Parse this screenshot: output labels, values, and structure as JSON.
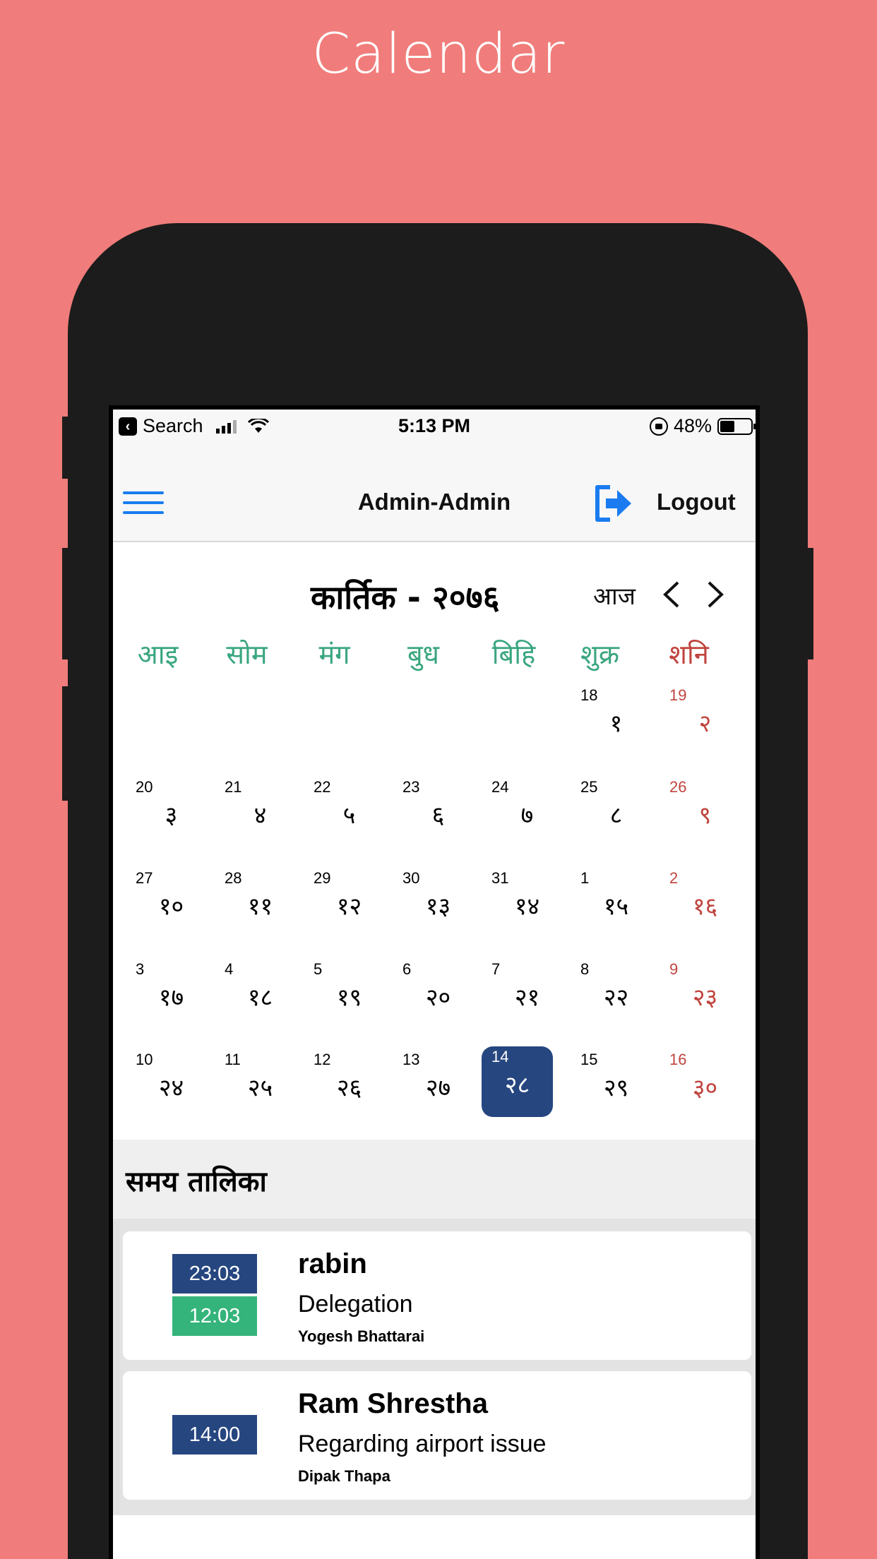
{
  "promo": {
    "title": "Calendar"
  },
  "status_bar": {
    "back_app": "Search",
    "time": "5:13 PM",
    "battery": "48%"
  },
  "nav": {
    "title": "Admin-Admin",
    "logout_label": "Logout"
  },
  "calendar": {
    "month_title": "कार्तिक - २०७६",
    "today_label": "आज",
    "weekdays": [
      "आइ",
      "सोम",
      "मंग",
      "बुध",
      "बिहि",
      "शुक्र",
      "शनि"
    ],
    "weeks": [
      [
        null,
        null,
        null,
        null,
        null,
        {
          "ad": "18",
          "bs": "१"
        },
        {
          "ad": "19",
          "bs": "२"
        }
      ],
      [
        {
          "ad": "20",
          "bs": "३"
        },
        {
          "ad": "21",
          "bs": "४"
        },
        {
          "ad": "22",
          "bs": "५"
        },
        {
          "ad": "23",
          "bs": "६"
        },
        {
          "ad": "24",
          "bs": "७"
        },
        {
          "ad": "25",
          "bs": "८"
        },
        {
          "ad": "26",
          "bs": "९"
        }
      ],
      [
        {
          "ad": "27",
          "bs": "१०"
        },
        {
          "ad": "28",
          "bs": "११"
        },
        {
          "ad": "29",
          "bs": "१२"
        },
        {
          "ad": "30",
          "bs": "१३"
        },
        {
          "ad": "31",
          "bs": "१४"
        },
        {
          "ad": "1",
          "bs": "१५"
        },
        {
          "ad": "2",
          "bs": "१६"
        }
      ],
      [
        {
          "ad": "3",
          "bs": "१७"
        },
        {
          "ad": "4",
          "bs": "१८"
        },
        {
          "ad": "5",
          "bs": "१९"
        },
        {
          "ad": "6",
          "bs": "२०"
        },
        {
          "ad": "7",
          "bs": "२१"
        },
        {
          "ad": "8",
          "bs": "२२"
        },
        {
          "ad": "9",
          "bs": "२३"
        }
      ],
      [
        {
          "ad": "10",
          "bs": "२४"
        },
        {
          "ad": "11",
          "bs": "२५"
        },
        {
          "ad": "12",
          "bs": "२६"
        },
        {
          "ad": "13",
          "bs": "२७"
        },
        {
          "ad": "14",
          "bs": "२८",
          "today": true
        },
        {
          "ad": "15",
          "bs": "२९"
        },
        {
          "ad": "16",
          "bs": "३०"
        }
      ]
    ]
  },
  "schedule": {
    "title": "समय तालिका",
    "events": [
      {
        "start": "23:03",
        "end": "12:03",
        "title": "rabin",
        "subtitle": "Delegation",
        "person": "Yogesh Bhattarai"
      },
      {
        "start": "14:00",
        "title": "Ram Shrestha",
        "subtitle": "Regarding airport issue",
        "person": "Dipak Thapa"
      }
    ]
  },
  "colors": {
    "background": "#F07D7B",
    "accent_blue": "#264680",
    "accent_green": "#34b47a",
    "weekday_green": "#3aa67f",
    "saturday_red": "#c0443e",
    "icon_blue": "#1a7cf0"
  }
}
